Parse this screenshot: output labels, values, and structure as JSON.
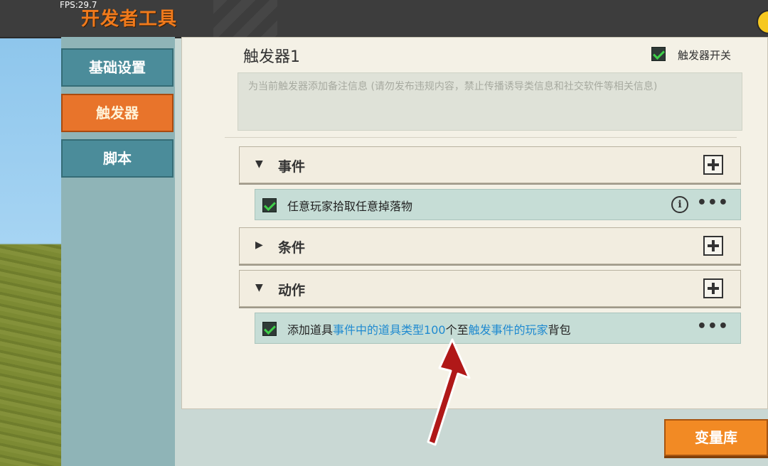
{
  "header": {
    "fps": "FPS:29.7",
    "title": "开发者工具"
  },
  "sidebar": {
    "items": [
      {
        "label": "基础设置",
        "active": false
      },
      {
        "label": "触发器",
        "active": true
      },
      {
        "label": "脚本",
        "active": false
      }
    ]
  },
  "trigger": {
    "name": "触发器1",
    "switch_label": "触发器开关",
    "switch_checked": true,
    "note_placeholder": "为当前触发器添加备注信息 (请勿发布违规内容，禁止传播诱导类信息和社交软件等相关信息)"
  },
  "sections": {
    "events": {
      "label": "事件",
      "expanded": true,
      "item": {
        "text": "任意玩家拾取任意掉落物",
        "checked": true,
        "info_icon": "info-icon"
      }
    },
    "conditions": {
      "label": "条件",
      "expanded": false
    },
    "actions": {
      "label": "动作",
      "expanded": true,
      "item": {
        "checked": true,
        "part1": "添加道具",
        "part2": "事件中的道具类型",
        "part3": "100",
        "part4": "个至",
        "part5": "触发事件的玩家",
        "part6": "背包"
      }
    }
  },
  "footer": {
    "variable_library_label": "变量库"
  },
  "colors": {
    "accent_orange": "#e8742b",
    "link_blue": "#1f8ad0",
    "annotation_arrow": "#b01818"
  }
}
